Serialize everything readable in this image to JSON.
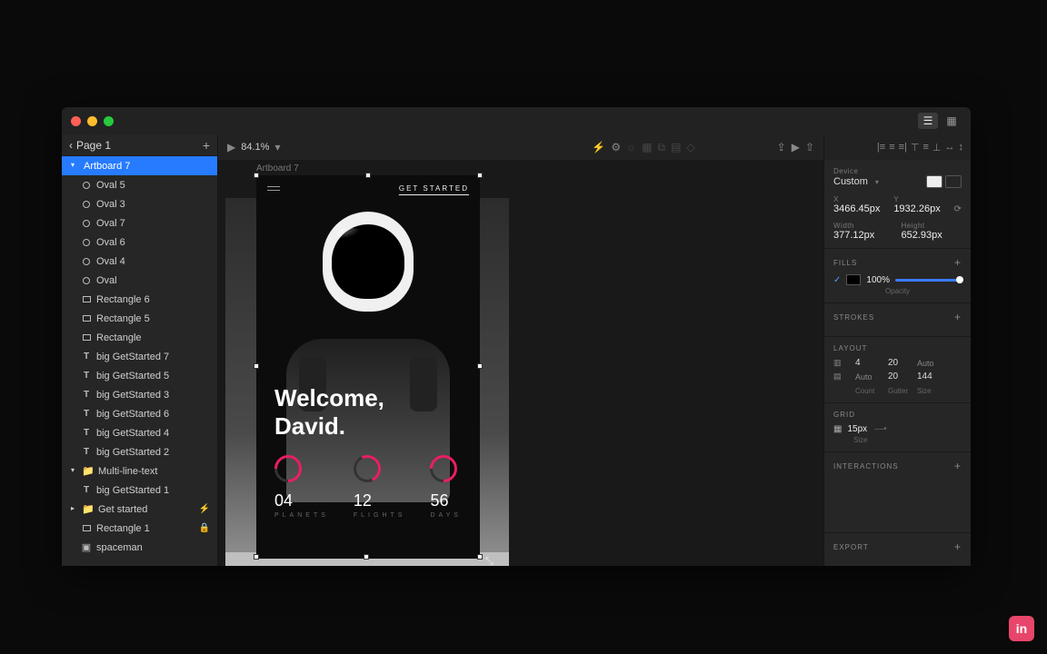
{
  "window": {
    "traffic": {
      "close": "#ff5f56",
      "min": "#ffbd2e",
      "max": "#27c93f"
    }
  },
  "sidebar": {
    "page_label": "Page 1",
    "items": [
      {
        "type": "artboard",
        "label": "Artboard 7",
        "selected": true
      },
      {
        "type": "oval",
        "label": "Oval 5"
      },
      {
        "type": "oval",
        "label": "Oval 3"
      },
      {
        "type": "oval",
        "label": "Oval 7"
      },
      {
        "type": "oval",
        "label": "Oval 6"
      },
      {
        "type": "oval",
        "label": "Oval 4"
      },
      {
        "type": "oval",
        "label": "Oval"
      },
      {
        "type": "rect",
        "label": "Rectangle 6"
      },
      {
        "type": "rect",
        "label": "Rectangle 5"
      },
      {
        "type": "rect",
        "label": "Rectangle"
      },
      {
        "type": "text",
        "label": "big GetStarted 7"
      },
      {
        "type": "text",
        "label": "big GetStarted 5"
      },
      {
        "type": "text",
        "label": "big GetStarted 3"
      },
      {
        "type": "text",
        "label": "big GetStarted 6"
      },
      {
        "type": "text",
        "label": "big GetStarted 4"
      },
      {
        "type": "text",
        "label": "big GetStarted 2"
      },
      {
        "type": "group",
        "label": "Multi-line-text",
        "open": true
      },
      {
        "type": "text",
        "label": "big GetStarted 1",
        "indent": 2
      },
      {
        "type": "group",
        "label": "Get started",
        "open": false,
        "trail": "bolt"
      },
      {
        "type": "rect",
        "label": "Rectangle 1",
        "trail": "lock"
      },
      {
        "type": "image",
        "label": "spaceman"
      }
    ]
  },
  "canvas": {
    "zoom": "84.1%",
    "artboard_label": "Artboard 7",
    "get_started": "GET STARTED",
    "welcome_line1": "Welcome,",
    "welcome_line2": "David.",
    "stats": [
      {
        "num": "04",
        "label": "PLANETS"
      },
      {
        "num": "12",
        "label": "FLIGHTS"
      },
      {
        "num": "56",
        "label": "DAYS"
      }
    ]
  },
  "inspector": {
    "device_label": "Device",
    "device_value": "Custom",
    "x_label": "X",
    "x_value": "3466.45px",
    "y_label": "Y",
    "y_value": "1932.26px",
    "w_label": "Width",
    "w_value": "377.12px",
    "h_label": "Height",
    "h_value": "652.93px",
    "fills_label": "FILLS",
    "fill_opacity": "100%",
    "opacity_label": "Opacity",
    "strokes_label": "STROKES",
    "layout_label": "LAYOUT",
    "layout": {
      "cols": "4",
      "gutter1": "20",
      "auto1": "Auto",
      "auto2": "Auto",
      "val2": "20",
      "val3": "144",
      "h_count": "Count",
      "h_gutter": "Gutter",
      "h_size": "Size"
    },
    "grid_label": "GRID",
    "grid_value": "15px",
    "grid_sub": "Size",
    "interactions_label": "INTERACTIONS",
    "export_label": "EXPORT"
  },
  "badge": "in"
}
